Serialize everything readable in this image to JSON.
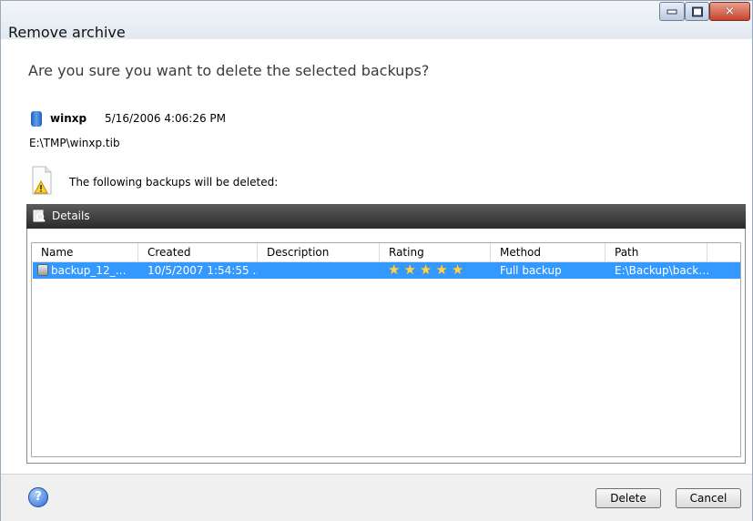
{
  "window": {
    "title": "Remove archive",
    "controls": [
      "minimize-icon",
      "maximize-icon",
      "close-icon"
    ]
  },
  "question": "Are you sure you want to delete the selected backups?",
  "archive": {
    "name": "winxp",
    "date": "5/16/2006 4:06:26 PM",
    "path": "E:\\TMP\\winxp.tib",
    "icon": "archive-icon"
  },
  "warning": {
    "text": "The following backups will be deleted:",
    "icon": "document-warning-icon"
  },
  "details": {
    "label": "Details",
    "icon": "details-icon"
  },
  "table": {
    "columns": [
      "Name",
      "Created",
      "Description",
      "Rating",
      "Method",
      "Path"
    ],
    "rows": [
      {
        "name": "backup_12_…",
        "created": "10/5/2007 1:54:55 …",
        "description": "",
        "rating": 5,
        "method": "Full backup",
        "path": "E:\\Backup\\back…",
        "selected": true
      }
    ]
  },
  "footer": {
    "delete_label": "Delete",
    "cancel_label": "Cancel",
    "help_icon": "help-icon"
  },
  "colors": {
    "selection": "#3399ff",
    "star": "#ffd34d",
    "details_bar": "#3a3a3a"
  }
}
